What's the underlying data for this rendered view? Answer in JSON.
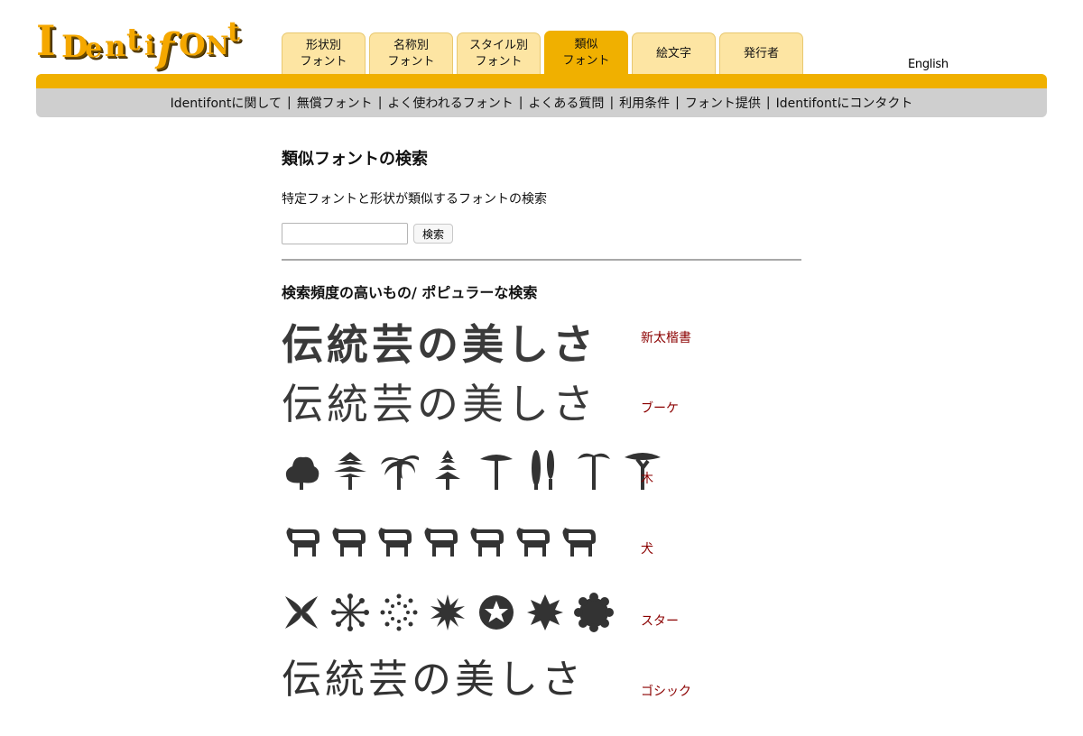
{
  "logo": {
    "text": "IDentifONt",
    "alt": "Identifont"
  },
  "tabs": [
    {
      "label": "形状別\nフォント",
      "active": false
    },
    {
      "label": "名称別\nフォント",
      "active": false
    },
    {
      "label": "スタイル別\nフォント",
      "active": false
    },
    {
      "label": "類似\nフォント",
      "active": true
    },
    {
      "label": "絵文字",
      "active": false
    },
    {
      "label": "発行者",
      "active": false
    }
  ],
  "language_link": "English",
  "nav": {
    "links": [
      "Identifontに関して",
      "無償フォント",
      "よく使われるフォント",
      "よくある質問",
      "利用条件",
      "フォント提供",
      "Identifontにコンタクト"
    ],
    "separator": "|"
  },
  "main": {
    "title": "類似フォントの検索",
    "description": "特定フォントと形状が類似するフォントの検索",
    "search": {
      "value": "",
      "placeholder": "",
      "button_label": "検索"
    },
    "popular_title": "検索頻度の高いもの/ ポピュラーな検索"
  },
  "samples": [
    {
      "preview_text": "伝統芸の美しさ",
      "font_name": "新太楷書"
    },
    {
      "preview_text": "伝統芸の美しさ",
      "font_name": "ブーケ"
    },
    {
      "preview_icons": [
        "bush-icon",
        "pine-tree-icon",
        "palm-tree-icon",
        "fir-tree-icon",
        "umbrella-pine-icon",
        "cypress-trees-icon",
        "tall-palm-icon",
        "acacia-tree-icon"
      ],
      "font_name": "木"
    },
    {
      "preview_icons": [
        "dog-icon",
        "dog-icon",
        "dog-icon",
        "dog-icon",
        "dog-icon",
        "dog-icon",
        "dog-icon"
      ],
      "font_name": "犬"
    },
    {
      "preview_icons": [
        "x-star-icon",
        "asterisk-star-icon",
        "dotted-burst-icon",
        "starburst-icon",
        "circled-star-icon",
        "eight-point-star-icon",
        "scalloped-circle-icon"
      ],
      "font_name": "スター"
    },
    {
      "preview_text": "伝統芸の美しさ",
      "font_name": "ゴシック"
    }
  ],
  "colors": {
    "accent": "#f0b000",
    "tab_bg": "#fde5a3",
    "nav_bg": "#cfcfcf",
    "link": "#8b0000",
    "logo": "#f5a800"
  }
}
